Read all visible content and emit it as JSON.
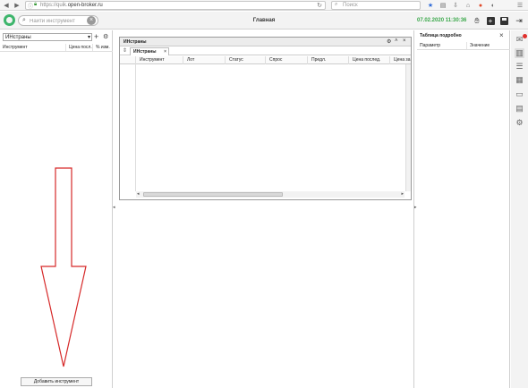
{
  "browser": {
    "url_prefix": "https://quik.",
    "url_domain": "open-broker.ru",
    "search_placeholder": "Поиск"
  },
  "header": {
    "search_placeholder": "Найти инструмент",
    "title": "Главная",
    "datetime": "07.02.2020 11:30:36",
    "accent_color": "#3aa84a"
  },
  "left_panel": {
    "list_name": "ИНстраны",
    "columns": [
      "Инструмент",
      "Цена посл.",
      "% изм."
    ],
    "add_button_label": "Добавить инструмент"
  },
  "widget": {
    "title": "ИНстраны",
    "tab_label": "ИНстраны",
    "columns": [
      "Инструмент",
      "Лот",
      "Статус",
      "Спрос",
      "Предл.",
      "Цена послед.",
      "Цена за"
    ]
  },
  "right_panel": {
    "title": "Таблица подробно",
    "columns": [
      "Параметр",
      "Значение"
    ]
  },
  "icons": {
    "toolbar": [
      "mail-icon",
      "layout-icon",
      "list-icon",
      "chart-icon",
      "window-icon",
      "table-icon",
      "gear-icon"
    ]
  },
  "annotation_color": "#d62828"
}
